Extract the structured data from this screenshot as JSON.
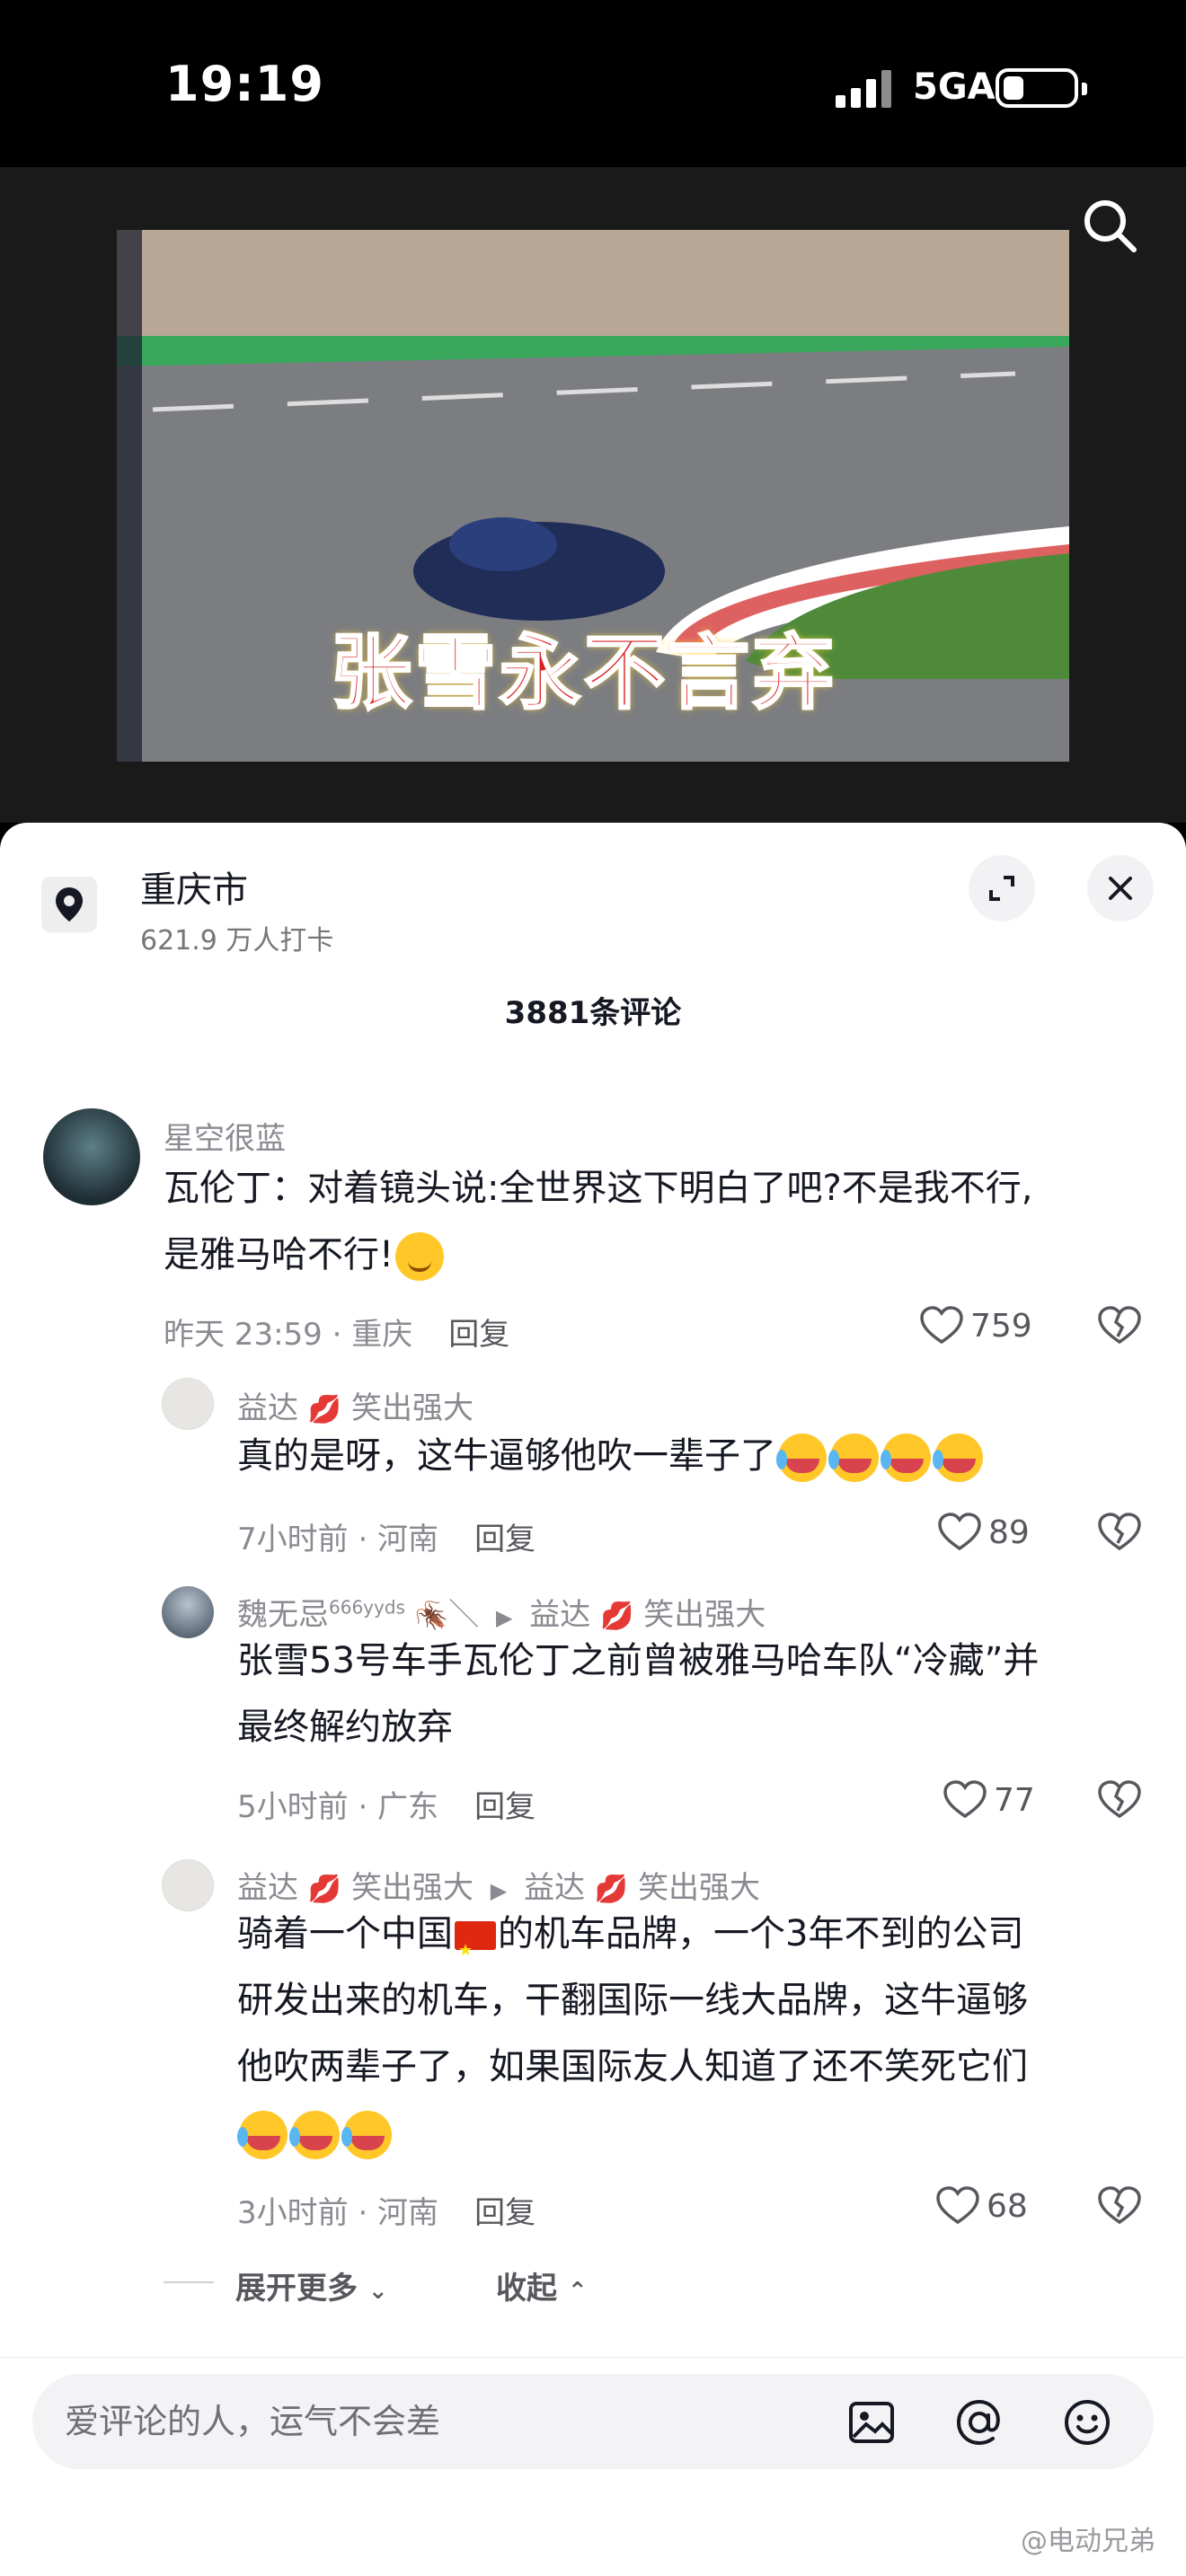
{
  "status_bar": {
    "time": "19:19",
    "network": "5GA"
  },
  "video": {
    "overlay_text": "张雪永不言弃"
  },
  "sheet": {
    "location": {
      "name": "重庆市",
      "checkins": "621.9 万人打卡"
    },
    "comment_count_label": "3881条评论",
    "comments": [
      {
        "user": "星空很蓝",
        "text_line1": "瓦伦丁：对着镜头说:全世界这下明白了吧?不是我不行,",
        "text_line2": "是雅马哈不行!",
        "time_place": "昨天 23:59 · 重庆",
        "reply_label": "回复",
        "likes": "759"
      },
      {
        "user": "益达",
        "user_suffix": "笑出强大",
        "text": "真的是呀，这牛逼够他吹一辈子了",
        "time_place": "7小时前 · 河南",
        "reply_label": "回复",
        "likes": "89"
      },
      {
        "user": "魏无忌",
        "user_superscript": "666yyds",
        "reply_to": "益达",
        "reply_to_suffix": "笑出强大",
        "text_line1": "张雪53号车手瓦伦丁之前曾被雅马哈车队“冷藏”并",
        "text_line2": "最终解约放弃",
        "time_place": "5小时前 · 广东",
        "reply_label": "回复",
        "likes": "77"
      },
      {
        "user": "益达",
        "user_suffix": "笑出强大",
        "reply_to": "益达",
        "reply_to_suffix": "笑出强大",
        "text_line1a": "骑着一个中国",
        "text_line1b": "的机车品牌，一个3年不到的公司",
        "text_line2": "研发出来的机车，干翻国际一线大品牌，这牛逼够",
        "text_line3": "他吹两辈子了，如果国际友人知道了还不笑死它们",
        "time_place": "3小时前 · 河南",
        "reply_label": "回复",
        "likes": "68"
      }
    ],
    "expand_label": "展开更多",
    "collapse_label": "收起"
  },
  "input": {
    "placeholder": "爱评论的人，运气不会差"
  },
  "watermark": "@电动兄弟",
  "icons": {
    "search": "search-icon",
    "location": "location-pin-icon",
    "expand": "expand-icon",
    "close": "close-icon",
    "like": "heart-icon",
    "dislike": "broken-heart-icon",
    "image": "image-icon",
    "mention": "at-icon",
    "emoji": "emoji-icon"
  },
  "colors": {
    "accent_text": "#161823",
    "meta": "#8a8b91",
    "sheet_bg": "#ffffff"
  }
}
